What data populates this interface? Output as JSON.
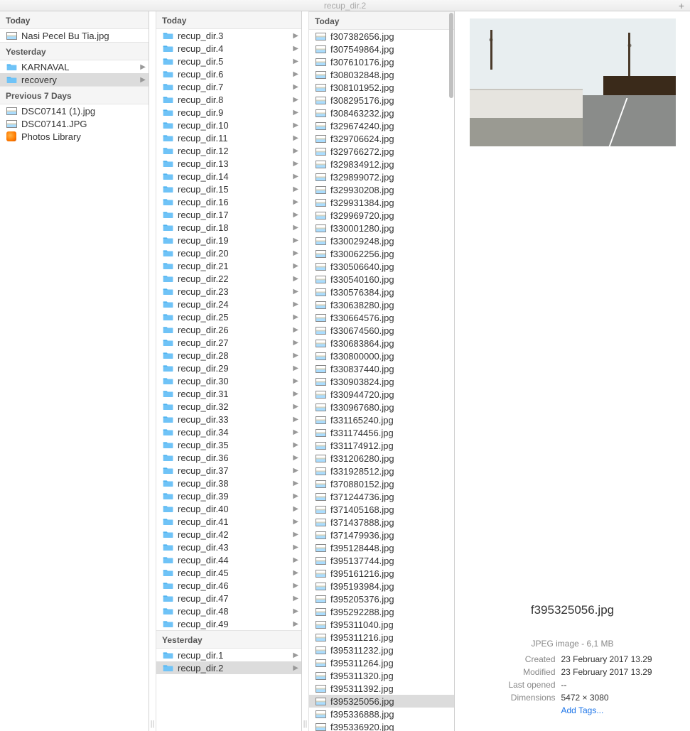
{
  "window": {
    "title": "recup_dir.2",
    "plus": "+"
  },
  "headers": {
    "today": "Today",
    "yesterday": "Yesterday",
    "prev7": "Previous 7 Days"
  },
  "col1": {
    "today": [
      {
        "name": "Nasi Pecel Bu Tia.jpg",
        "type": "img"
      }
    ],
    "yesterday": [
      {
        "name": "KARNAVAL",
        "type": "folder",
        "chev": true
      },
      {
        "name": "recovery",
        "type": "folder",
        "chev": true,
        "selected": true
      }
    ],
    "prev7": [
      {
        "name": "DSC07141 (1).jpg",
        "type": "img"
      },
      {
        "name": "DSC07141.JPG",
        "type": "img"
      },
      {
        "name": "Photos Library",
        "type": "lib"
      }
    ]
  },
  "col2": {
    "today": [
      "recup_dir.3",
      "recup_dir.4",
      "recup_dir.5",
      "recup_dir.6",
      "recup_dir.7",
      "recup_dir.8",
      "recup_dir.9",
      "recup_dir.10",
      "recup_dir.11",
      "recup_dir.12",
      "recup_dir.13",
      "recup_dir.14",
      "recup_dir.15",
      "recup_dir.16",
      "recup_dir.17",
      "recup_dir.18",
      "recup_dir.19",
      "recup_dir.20",
      "recup_dir.21",
      "recup_dir.22",
      "recup_dir.23",
      "recup_dir.24",
      "recup_dir.25",
      "recup_dir.26",
      "recup_dir.27",
      "recup_dir.28",
      "recup_dir.29",
      "recup_dir.30",
      "recup_dir.31",
      "recup_dir.32",
      "recup_dir.33",
      "recup_dir.34",
      "recup_dir.35",
      "recup_dir.36",
      "recup_dir.37",
      "recup_dir.38",
      "recup_dir.39",
      "recup_dir.40",
      "recup_dir.41",
      "recup_dir.42",
      "recup_dir.43",
      "recup_dir.44",
      "recup_dir.45",
      "recup_dir.46",
      "recup_dir.47",
      "recup_dir.48",
      "recup_dir.49"
    ],
    "yesterday": [
      {
        "name": "recup_dir.1",
        "selected": false
      },
      {
        "name": "recup_dir.2",
        "selected": true
      }
    ]
  },
  "col3": {
    "today": [
      "f307382656.jpg",
      "f307549864.jpg",
      "f307610176.jpg",
      "f308032848.jpg",
      "f308101952.jpg",
      "f308295176.jpg",
      "f308463232.jpg",
      "f329674240.jpg",
      "f329706624.jpg",
      "f329766272.jpg",
      "f329834912.jpg",
      "f329899072.jpg",
      "f329930208.jpg",
      "f329931384.jpg",
      "f329969720.jpg",
      "f330001280.jpg",
      "f330029248.jpg",
      "f330062256.jpg",
      "f330506640.jpg",
      "f330540160.jpg",
      "f330576384.jpg",
      "f330638280.jpg",
      "f330664576.jpg",
      "f330674560.jpg",
      "f330683864.jpg",
      "f330800000.jpg",
      "f330837440.jpg",
      "f330903824.jpg",
      "f330944720.jpg",
      "f330967680.jpg",
      "f331165240.jpg",
      "f331174456.jpg",
      "f331174912.jpg",
      "f331206280.jpg",
      "f331928512.jpg",
      "f370880152.jpg",
      "f371244736.jpg",
      "f371405168.jpg",
      "f371437888.jpg",
      "f371479936.jpg",
      "f395128448.jpg",
      "f395137744.jpg",
      "f395161216.jpg",
      "f395193984.jpg",
      "f395205376.jpg",
      "f395292288.jpg",
      "f395311040.jpg",
      "f395311216.jpg",
      "f395311232.jpg",
      "f395311264.jpg",
      "f395311320.jpg",
      "f395311392.jpg",
      "f395325056.jpg",
      "f395336888.jpg",
      "f395336920.jpg"
    ],
    "selected": "f395325056.jpg"
  },
  "preview": {
    "filename": "f395325056.jpg",
    "kind": "JPEG image - 6,1 MB",
    "rows": [
      {
        "k": "Created",
        "v": "23 February 2017 13.29"
      },
      {
        "k": "Modified",
        "v": "23 February 2017 13.29"
      },
      {
        "k": "Last opened",
        "v": "--"
      },
      {
        "k": "Dimensions",
        "v": "5472 × 3080"
      }
    ],
    "add_tags": "Add Tags..."
  }
}
